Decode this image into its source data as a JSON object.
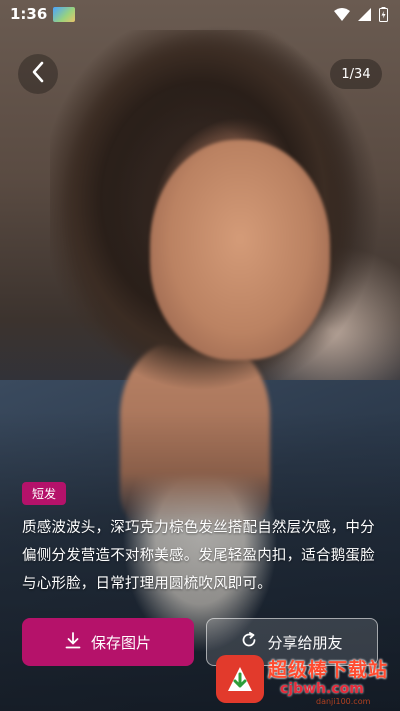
{
  "status_bar": {
    "time": "1:36",
    "icons": [
      "app-thumbnail-icon",
      "wifi-icon",
      "cell-signal-icon",
      "battery-icon"
    ]
  },
  "header": {
    "back_icon": "chevron-left-icon",
    "page_counter": "1/34"
  },
  "photo": {
    "subject": "portrait"
  },
  "caption": {
    "tag": "短发",
    "description": "质感波波头，深巧克力棕色发丝搭配自然层次感，中分偏侧分发营造不对称美感。发尾轻盈内扣，适合鹅蛋脸与心形脸，日常打理用圆梳吹风即可。"
  },
  "actions": {
    "save_label": "保存图片",
    "save_icon": "download-icon",
    "share_label": "分享给朋友",
    "share_icon": "share-refresh-icon"
  },
  "watermark": {
    "title": "超级棒下载站",
    "url": "cjbwh.com",
    "sub": "danji100.com"
  },
  "colors": {
    "accent": "#b5126a",
    "watermark_red": "#e23a2c"
  }
}
